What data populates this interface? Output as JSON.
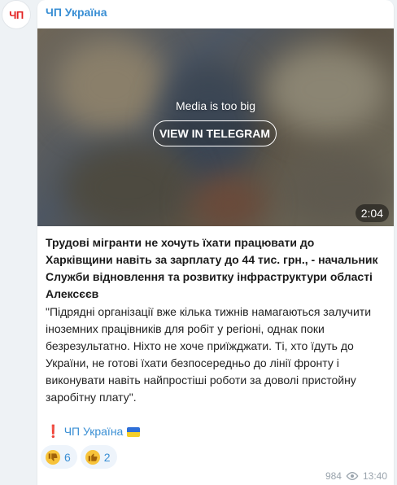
{
  "channel": {
    "name": "ЧП Україна",
    "avatar_text": "ЧП"
  },
  "media": {
    "notice": "Media is too big",
    "button_label": "VIEW IN TELEGRAM",
    "duration": "2:04"
  },
  "post": {
    "headline": "Трудові мігранти не хочуть їхати працювати до Харківщини навіть за зарплату до 44 тис. грн., - начальник Служби відновлення та розвитку інфраструктури області Алексєєв",
    "quote": "\"Підрядні організації вже кілька тижнів намагаються залучити іноземних працівників для робіт у регіоні, однак поки безрезультатно. Ніхто не хоче приїжджати. Ті, хто їдуть до України, не готові їхати безпосередньо до лінії фронту і виконувати навіть найпростіші роботи за доволі пристойну заробітну плату\".",
    "signature_mark": "❗",
    "signature_link": "ЧП Україна"
  },
  "reactions": [
    {
      "emoji": "thumbs-down",
      "glyph": "👎",
      "count": "6"
    },
    {
      "emoji": "thumbs-up",
      "glyph": "👍",
      "count": "2"
    }
  ],
  "meta": {
    "views": "984",
    "time": "13:40"
  },
  "colors": {
    "accent": "#3a8fd4",
    "background": "#eef2f5",
    "brand_red": "#e32222"
  }
}
